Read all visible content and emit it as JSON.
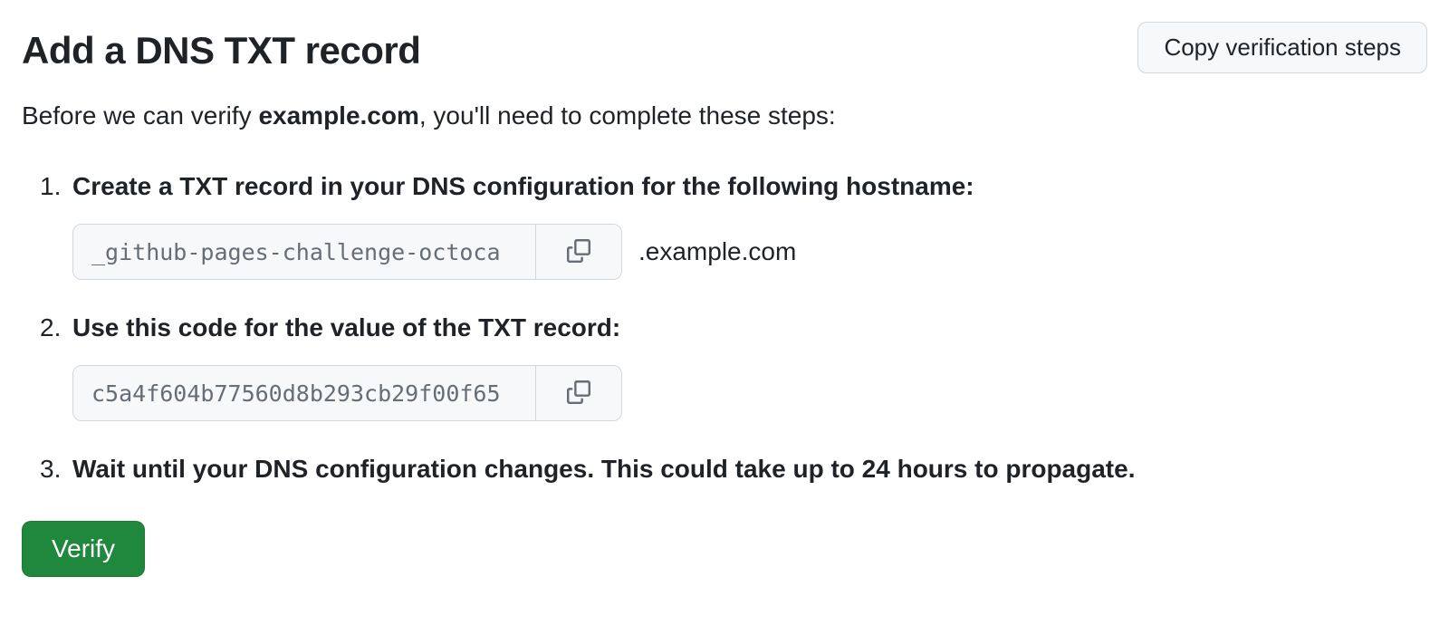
{
  "header": {
    "title": "Add a DNS TXT record",
    "copy_steps_label": "Copy verification steps"
  },
  "intro": {
    "prefix": "Before we can verify ",
    "domain": "example.com",
    "suffix": ", you'll need to complete these steps:"
  },
  "steps": {
    "step1": {
      "label": "Create a TXT record in your DNS configuration for the following hostname:",
      "hostname_value": "_github-pages-challenge-octoca",
      "domain_suffix": ".example.com"
    },
    "step2": {
      "label": "Use this code for the value of the TXT record:",
      "code_value": "c5a4f604b77560d8b293cb29f00f65"
    },
    "step3": {
      "label": "Wait until your DNS configuration changes. This could take up to 24 hours to propagate."
    }
  },
  "verify_button_label": "Verify"
}
